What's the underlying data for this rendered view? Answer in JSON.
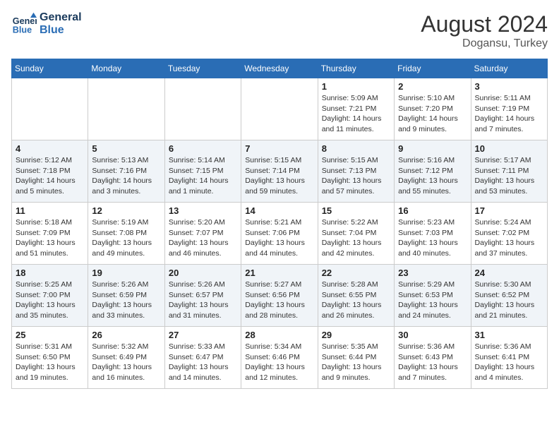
{
  "header": {
    "logo_line1": "General",
    "logo_line2": "Blue",
    "month_year": "August 2024",
    "location": "Dogansu, Turkey"
  },
  "days_of_week": [
    "Sunday",
    "Monday",
    "Tuesday",
    "Wednesday",
    "Thursday",
    "Friday",
    "Saturday"
  ],
  "weeks": [
    [
      {
        "day": "",
        "info": ""
      },
      {
        "day": "",
        "info": ""
      },
      {
        "day": "",
        "info": ""
      },
      {
        "day": "",
        "info": ""
      },
      {
        "day": "1",
        "info": "Sunrise: 5:09 AM\nSunset: 7:21 PM\nDaylight: 14 hours\nand 11 minutes."
      },
      {
        "day": "2",
        "info": "Sunrise: 5:10 AM\nSunset: 7:20 PM\nDaylight: 14 hours\nand 9 minutes."
      },
      {
        "day": "3",
        "info": "Sunrise: 5:11 AM\nSunset: 7:19 PM\nDaylight: 14 hours\nand 7 minutes."
      }
    ],
    [
      {
        "day": "4",
        "info": "Sunrise: 5:12 AM\nSunset: 7:18 PM\nDaylight: 14 hours\nand 5 minutes."
      },
      {
        "day": "5",
        "info": "Sunrise: 5:13 AM\nSunset: 7:16 PM\nDaylight: 14 hours\nand 3 minutes."
      },
      {
        "day": "6",
        "info": "Sunrise: 5:14 AM\nSunset: 7:15 PM\nDaylight: 14 hours\nand 1 minute."
      },
      {
        "day": "7",
        "info": "Sunrise: 5:15 AM\nSunset: 7:14 PM\nDaylight: 13 hours\nand 59 minutes."
      },
      {
        "day": "8",
        "info": "Sunrise: 5:15 AM\nSunset: 7:13 PM\nDaylight: 13 hours\nand 57 minutes."
      },
      {
        "day": "9",
        "info": "Sunrise: 5:16 AM\nSunset: 7:12 PM\nDaylight: 13 hours\nand 55 minutes."
      },
      {
        "day": "10",
        "info": "Sunrise: 5:17 AM\nSunset: 7:11 PM\nDaylight: 13 hours\nand 53 minutes."
      }
    ],
    [
      {
        "day": "11",
        "info": "Sunrise: 5:18 AM\nSunset: 7:09 PM\nDaylight: 13 hours\nand 51 minutes."
      },
      {
        "day": "12",
        "info": "Sunrise: 5:19 AM\nSunset: 7:08 PM\nDaylight: 13 hours\nand 49 minutes."
      },
      {
        "day": "13",
        "info": "Sunrise: 5:20 AM\nSunset: 7:07 PM\nDaylight: 13 hours\nand 46 minutes."
      },
      {
        "day": "14",
        "info": "Sunrise: 5:21 AM\nSunset: 7:06 PM\nDaylight: 13 hours\nand 44 minutes."
      },
      {
        "day": "15",
        "info": "Sunrise: 5:22 AM\nSunset: 7:04 PM\nDaylight: 13 hours\nand 42 minutes."
      },
      {
        "day": "16",
        "info": "Sunrise: 5:23 AM\nSunset: 7:03 PM\nDaylight: 13 hours\nand 40 minutes."
      },
      {
        "day": "17",
        "info": "Sunrise: 5:24 AM\nSunset: 7:02 PM\nDaylight: 13 hours\nand 37 minutes."
      }
    ],
    [
      {
        "day": "18",
        "info": "Sunrise: 5:25 AM\nSunset: 7:00 PM\nDaylight: 13 hours\nand 35 minutes."
      },
      {
        "day": "19",
        "info": "Sunrise: 5:26 AM\nSunset: 6:59 PM\nDaylight: 13 hours\nand 33 minutes."
      },
      {
        "day": "20",
        "info": "Sunrise: 5:26 AM\nSunset: 6:57 PM\nDaylight: 13 hours\nand 31 minutes."
      },
      {
        "day": "21",
        "info": "Sunrise: 5:27 AM\nSunset: 6:56 PM\nDaylight: 13 hours\nand 28 minutes."
      },
      {
        "day": "22",
        "info": "Sunrise: 5:28 AM\nSunset: 6:55 PM\nDaylight: 13 hours\nand 26 minutes."
      },
      {
        "day": "23",
        "info": "Sunrise: 5:29 AM\nSunset: 6:53 PM\nDaylight: 13 hours\nand 24 minutes."
      },
      {
        "day": "24",
        "info": "Sunrise: 5:30 AM\nSunset: 6:52 PM\nDaylight: 13 hours\nand 21 minutes."
      }
    ],
    [
      {
        "day": "25",
        "info": "Sunrise: 5:31 AM\nSunset: 6:50 PM\nDaylight: 13 hours\nand 19 minutes."
      },
      {
        "day": "26",
        "info": "Sunrise: 5:32 AM\nSunset: 6:49 PM\nDaylight: 13 hours\nand 16 minutes."
      },
      {
        "day": "27",
        "info": "Sunrise: 5:33 AM\nSunset: 6:47 PM\nDaylight: 13 hours\nand 14 minutes."
      },
      {
        "day": "28",
        "info": "Sunrise: 5:34 AM\nSunset: 6:46 PM\nDaylight: 13 hours\nand 12 minutes."
      },
      {
        "day": "29",
        "info": "Sunrise: 5:35 AM\nSunset: 6:44 PM\nDaylight: 13 hours\nand 9 minutes."
      },
      {
        "day": "30",
        "info": "Sunrise: 5:36 AM\nSunset: 6:43 PM\nDaylight: 13 hours\nand 7 minutes."
      },
      {
        "day": "31",
        "info": "Sunrise: 5:36 AM\nSunset: 6:41 PM\nDaylight: 13 hours\nand 4 minutes."
      }
    ]
  ]
}
